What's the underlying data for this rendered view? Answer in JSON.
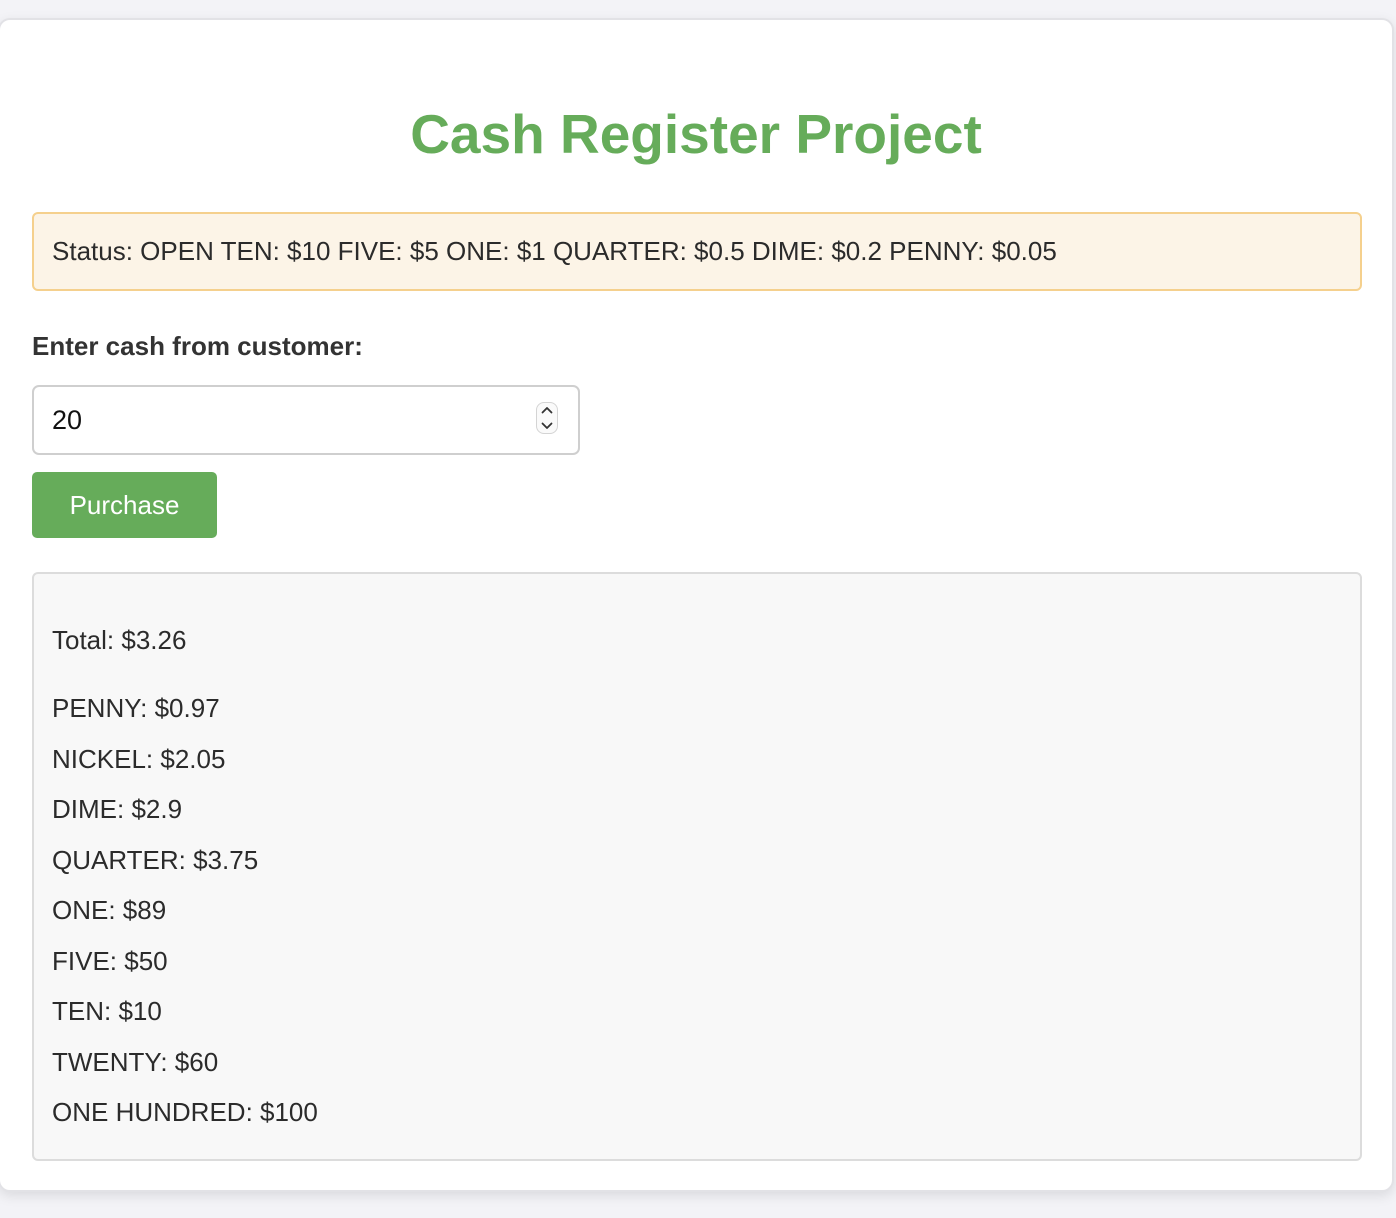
{
  "app": {
    "title": "Cash Register Project"
  },
  "status": {
    "text": "Status: OPEN TEN: $10 FIVE: $5 ONE: $1 QUARTER: $0.5 DIME: $0.2 PENNY: $0.05"
  },
  "form": {
    "cash_label": "Enter cash from customer:",
    "cash_value": "20",
    "purchase_label": "Purchase"
  },
  "output": {
    "total": "Total: $3.26",
    "drawer": [
      "PENNY: $0.97",
      "NICKEL: $2.05",
      "DIME: $2.9",
      "QUARTER: $3.75",
      "ONE: $89",
      "FIVE: $50",
      "TEN: $10",
      "TWENTY: $60",
      "ONE HUNDRED: $100"
    ]
  },
  "colors": {
    "accent": "#66ac5a",
    "status_bg": "#fcf4e7",
    "status_border": "#f5d08d",
    "output_bg": "#f8f8f8",
    "page_bg": "#f3f3f7"
  },
  "icons": {
    "stepper_up": "chevron-up-icon",
    "stepper_down": "chevron-down-icon"
  }
}
